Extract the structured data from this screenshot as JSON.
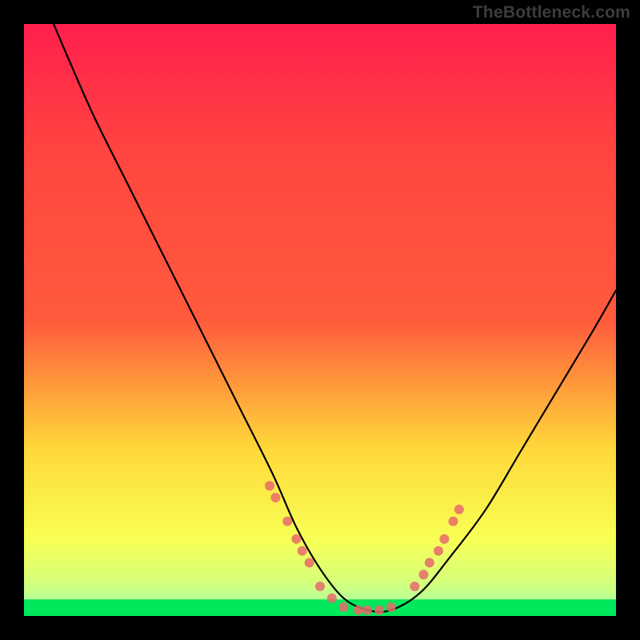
{
  "watermark": "TheBottleneck.com",
  "chart_data": {
    "type": "line",
    "title": "",
    "xlabel": "",
    "ylabel": "",
    "xlim": [
      0,
      100
    ],
    "ylim": [
      0,
      100
    ],
    "grid": false,
    "legend": false,
    "background_gradient": {
      "top": "#ff1f4d",
      "mid_top": "#ff5a3c",
      "mid": "#ffd93a",
      "low": "#f8ff55",
      "band": "#d7ff79",
      "bottom": "#00e85b"
    },
    "series": [
      {
        "name": "bottleneck-curve",
        "color": "#000000",
        "x": [
          5,
          8,
          12,
          18,
          24,
          30,
          36,
          42,
          46,
          50,
          54,
          58,
          62,
          67,
          72,
          78,
          84,
          90,
          96,
          100
        ],
        "y": [
          100,
          93,
          84,
          72,
          60,
          48,
          36,
          24,
          15,
          8,
          3,
          1,
          1,
          4,
          10,
          18,
          28,
          38,
          48,
          55
        ]
      },
      {
        "name": "highlight-dots-left",
        "type": "scatter",
        "color": "#e86a6a",
        "x": [
          41.5,
          42.5,
          44.5,
          46.0,
          47.0,
          48.2,
          50.0,
          52.0,
          54.0,
          56.5,
          58.0,
          60.0,
          62.0
        ],
        "y": [
          22,
          20,
          16,
          13,
          11,
          9,
          5,
          3,
          1.5,
          1,
          1,
          1,
          1.5
        ]
      },
      {
        "name": "highlight-dots-right",
        "type": "scatter",
        "color": "#e86a6a",
        "x": [
          66.0,
          67.5,
          68.5,
          70.0,
          71.0,
          72.5,
          73.5
        ],
        "y": [
          5,
          7,
          9,
          11,
          13,
          16,
          18
        ]
      }
    ],
    "green_band_y_fraction": 0.028
  }
}
